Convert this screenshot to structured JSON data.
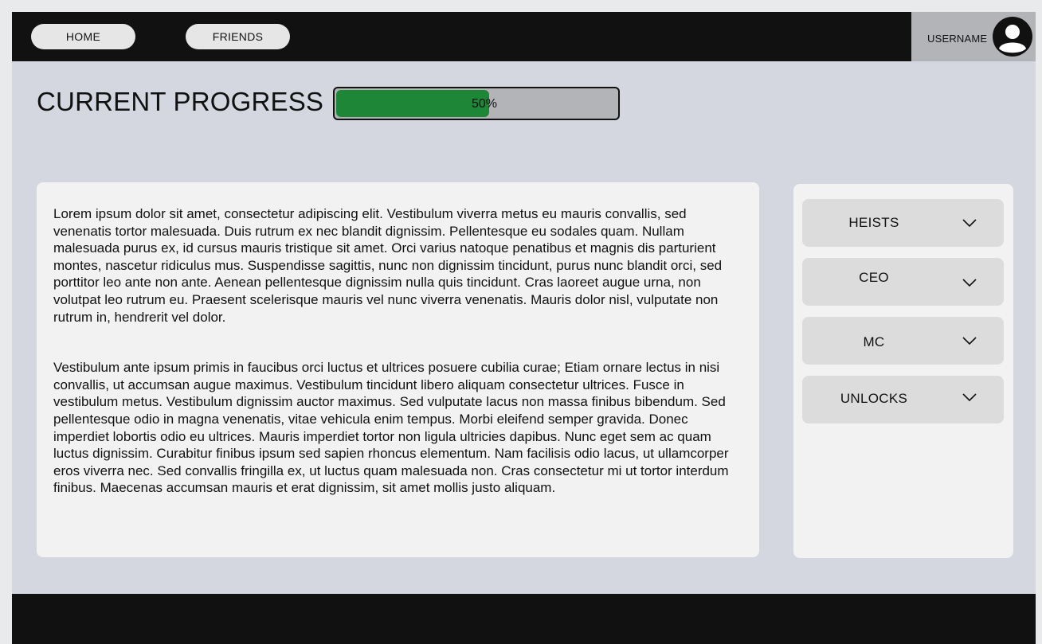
{
  "nav": {
    "home_label": "HOME",
    "friends_label": "FRIENDS"
  },
  "user": {
    "username": "USERNAME",
    "avatar_icon": "user-avatar-icon"
  },
  "progress": {
    "title": "CURRENT PROGRESS",
    "percent": 50,
    "label": "50%",
    "fill_color": "#1d8637"
  },
  "content": {
    "paragraphs": [
      "Lorem ipsum dolor sit amet, consectetur adipiscing elit. Vestibulum viverra metus eu mauris convallis, sed venenatis tortor malesuada. Duis rutrum ex nec blandit dignissim. Pellentesque eu sodales quam. Nullam malesuada purus ex, id cursus mauris tristique sit amet. Orci varius natoque penatibus et magnis dis parturient montes, nascetur ridiculus mus. Suspendisse sagittis, nunc non dignissim tincidunt, purus nunc blandit orci, sed porttitor leo ante non ante. Aenean pellentesque dignissim nulla quis tincidunt. Cras laoreet augue urna, non volutpat leo rutrum eu. Praesent scelerisque mauris vel nunc viverra venenatis. Mauris dolor nisl, vulputate non rutrum in, hendrerit vel dolor.",
      "Vestibulum ante ipsum primis in faucibus orci luctus et ultrices posuere cubilia curae; Etiam ornare lectus in nisi convallis, ut accumsan augue maximus. Vestibulum tincidunt libero aliquam consectetur ultrices. Fusce in vestibulum metus. Vestibulum dignissim auctor maximus. Sed vulputate lacus non massa finibus bibendum. Sed pellentesque odio in magna venenatis, vitae vehicula enim tempus. Morbi eleifend semper gravida. Donec imperdiet lobortis odio eu ultrices. Mauris imperdiet tortor non ligula ultricies dapibus. Nunc eget sem ac quam luctus dignissim. Curabitur finibus ipsum sed sapien rhoncus elementum. Nam facilisis odio lacus, ut ullamcorper eros viverra nec. Sed convallis fringilla ex, ut luctus quam malesuada non. Cras consectetur mi ut tortor interdum finibus. Maecenas accumsan mauris et erat dignissim, sit amet mollis justo aliquam."
    ]
  },
  "sidebar": {
    "items": [
      {
        "label": "HEISTS",
        "icon": "chevron-down-icon"
      },
      {
        "label": "CEO",
        "icon": "chevron-down-icon"
      },
      {
        "label": "MC",
        "icon": "chevron-down-icon"
      },
      {
        "label": "UNLOCKS",
        "icon": "chevron-down-icon"
      }
    ]
  },
  "colors": {
    "nav_background": "#111111",
    "page_background": "#d4d7df",
    "card_background": "#f2f2f2",
    "progress_track": "#b3b4b8"
  }
}
